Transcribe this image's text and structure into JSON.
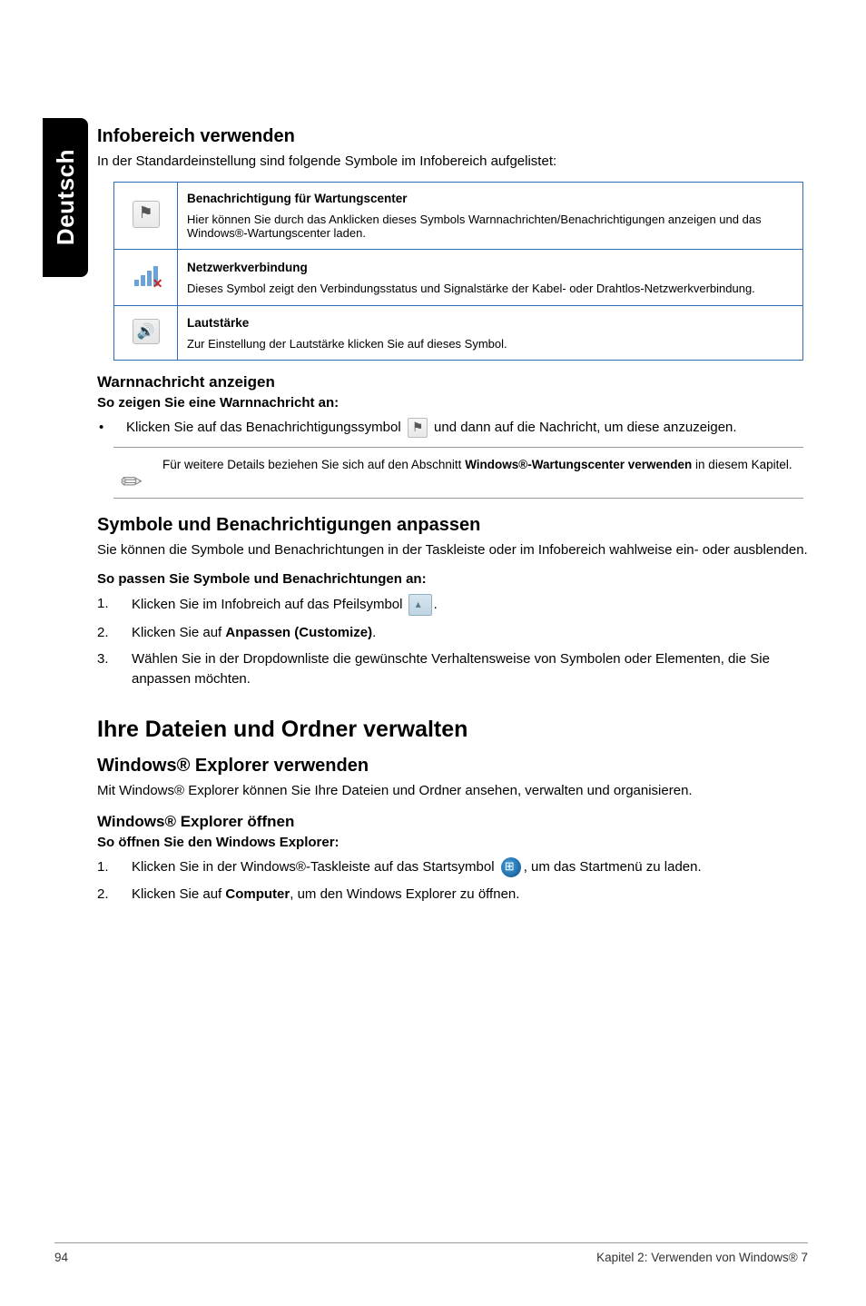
{
  "side_tab": "Deutsch",
  "s1": {
    "title": "Infobereich verwenden",
    "intro": "In der Standardeinstellung sind folgende Symbole im Infobereich aufgelistet:",
    "rows": [
      {
        "title": "Benachrichtigung für Wartungscenter",
        "body": "Hier können Sie durch das Anklicken dieses Symbols Warnnachrichten/Benachrichtigungen anzeigen und das Windows®-Wartungscenter laden."
      },
      {
        "title": "Netzwerkverbindung",
        "body": "Dieses Symbol zeigt den Verbindungsstatus und Signalstärke der Kabel- oder Drahtlos-Netzwerkverbindung."
      },
      {
        "title": "Lautstärke",
        "body": "Zur Einstellung der Lautstärke klicken Sie auf dieses Symbol."
      }
    ]
  },
  "warn": {
    "title": "Warnnachricht anzeigen",
    "lead": "So zeigen Sie eine Warnnachricht an:",
    "bullet_pre": "Klicken Sie auf das Benachrichtigungssymbol ",
    "bullet_post": " und dann auf die Nachricht, um diese anzuzeigen."
  },
  "note": {
    "pre": "Für weitere Details beziehen Sie sich auf den Abschnitt ",
    "bold": "Windows®-Wartungscenter verwenden",
    "post": " in diesem Kapitel."
  },
  "custom": {
    "title": "Symbole und Benachrichtigungen anpassen",
    "intro": "Sie können die Symbole und Benachrichtungen in der Taskleiste oder im Infobereich wahlweise ein- oder ausblenden.",
    "lead": "So passen Sie Symbole und Benachrichtungen an:",
    "step1_pre": "Klicken Sie im Infobreich auf das Pfeilsymbol ",
    "step1_post": ".",
    "step2_pre": "Klicken Sie auf ",
    "step2_bold": "Anpassen (Customize)",
    "step2_post": ".",
    "step3": "Wählen Sie in der Dropdownliste die gewünschte Verhaltensweise von Symbolen oder Elementen, die Sie anpassen möchten."
  },
  "files": {
    "h2": "Ihre Dateien und Ordner verwalten",
    "h3": "Windows® Explorer verwenden",
    "intro": "Mit Windows® Explorer können Sie Ihre Dateien und Ordner ansehen, verwalten und organisieren.",
    "open_h": "Windows® Explorer öffnen",
    "open_lead": "So öffnen Sie den Windows Explorer:",
    "s1_pre": "Klicken Sie in der Windows®-Taskleiste auf das Startsymbol ",
    "s1_post": ", um das Startmenü zu laden.",
    "s2_pre": "Klicken Sie auf ",
    "s2_bold": "Computer",
    "s2_post": ", um den Windows Explorer zu öffnen."
  },
  "footer": {
    "page": "94",
    "chapter": "Kapitel 2: Verwenden von Windows® 7"
  },
  "chart_data": null
}
